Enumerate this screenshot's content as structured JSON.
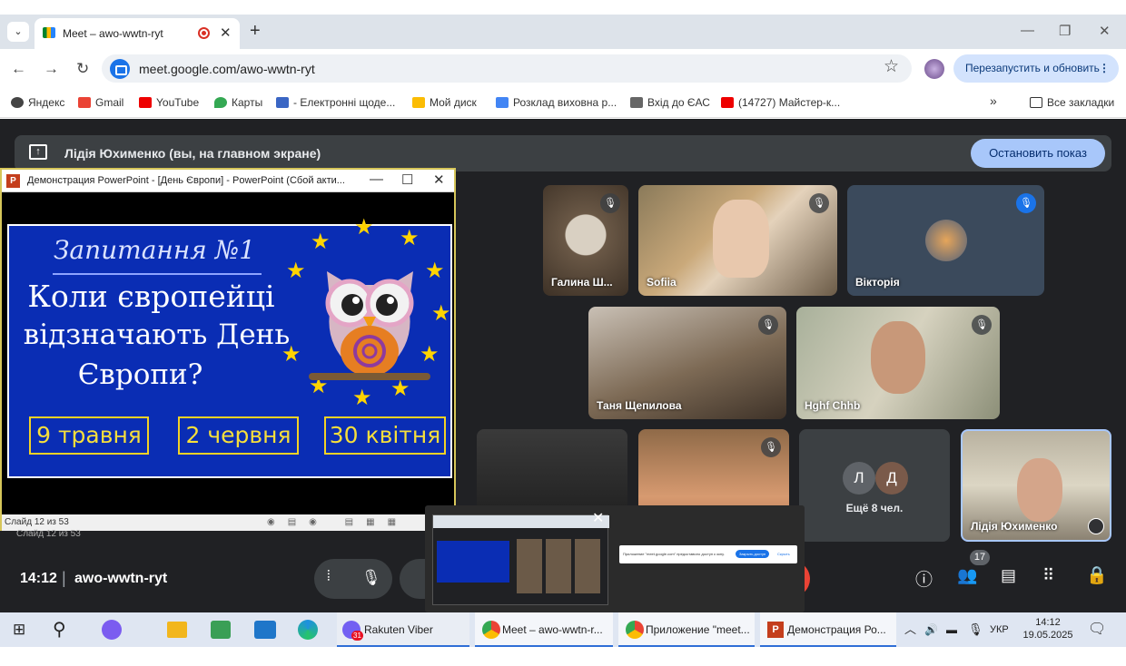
{
  "browser": {
    "tab_title": "Meet – awo-wwtn-ryt",
    "url": "meet.google.com/awo-wwtn-ryt",
    "relaunch_label": "Перезапустить и обновить",
    "bookmarks": [
      {
        "label": "Яндекс",
        "color": "#444"
      },
      {
        "label": "Gmail",
        "color": "#ea4335"
      },
      {
        "label": "YouTube",
        "color": "#e00"
      },
      {
        "label": "Карты",
        "color": "#34a853"
      },
      {
        "label": "- Електронні щоде...",
        "color": "#3a66c4"
      },
      {
        "label": "Мой диск",
        "color": "#fbbc04"
      },
      {
        "label": "Розклад виховна р...",
        "color": "#4285f4"
      },
      {
        "label": "Вхід до ЄАС",
        "color": "#666"
      },
      {
        "label": "(14727) Майстер-к...",
        "color": "#e00"
      }
    ],
    "bookmarks_more": "»",
    "all_bookmarks": "Все закладки"
  },
  "meet": {
    "banner_text": "Лідія Юхименко (вы, на главном экране)",
    "stop_button": "Остановить показ",
    "meeting_time": "14:12",
    "meeting_code": "awo-wwtn-ryt",
    "people_count": "17",
    "participants": [
      {
        "name": "Галина Ш...",
        "muted": true
      },
      {
        "name": "Sofiia",
        "muted": true
      },
      {
        "name": "Вікторія",
        "muted": true
      },
      {
        "name": "Таня Щепилова",
        "muted": true
      },
      {
        "name": "Hghf Chhb",
        "muted": true
      },
      {
        "name": "",
        "muted": false
      },
      {
        "name": "",
        "muted": true
      },
      {
        "name": "Лідія Юхименко",
        "muted": false
      }
    ],
    "more_tile": {
      "avatars": [
        "Л",
        "Д"
      ],
      "label": "Ещё 8 чел."
    }
  },
  "powerpoint": {
    "window_title": "Демонстрация PowerPoint - [День Європи] - PowerPoint (Сбой акти...",
    "status": "Слайд 12 из 53",
    "status_shadow": "Слайд 12 из 53",
    "slide": {
      "heading": "Запитання №1",
      "question_line1": "Коли європейці",
      "question_line2": "відзначають День",
      "question_line3": "Європи?",
      "answers": [
        "9 травня",
        "2 червня",
        "30 квітня"
      ]
    }
  },
  "thumbnail": {
    "dialog_text": "Приложение \"meet.google.com\" предоставило доступ к окну.",
    "dialog_button": "Закрыть доступ",
    "dialog_link": "Скрыть"
  },
  "taskbar": {
    "items": [
      "Rakuten Viber",
      "Meet – awo-wwtn-r...",
      "Приложение \"meet...",
      "Демонстрация Ро..."
    ],
    "viber_badge": "31",
    "lang": "УКР",
    "time": "14:12",
    "date": "19.05.2025"
  },
  "colors": {
    "meet_bg": "#202124",
    "slide_bg": "#0a2db4",
    "accent": "#a8c7fa",
    "answer_yellow": "#f7df3b"
  }
}
